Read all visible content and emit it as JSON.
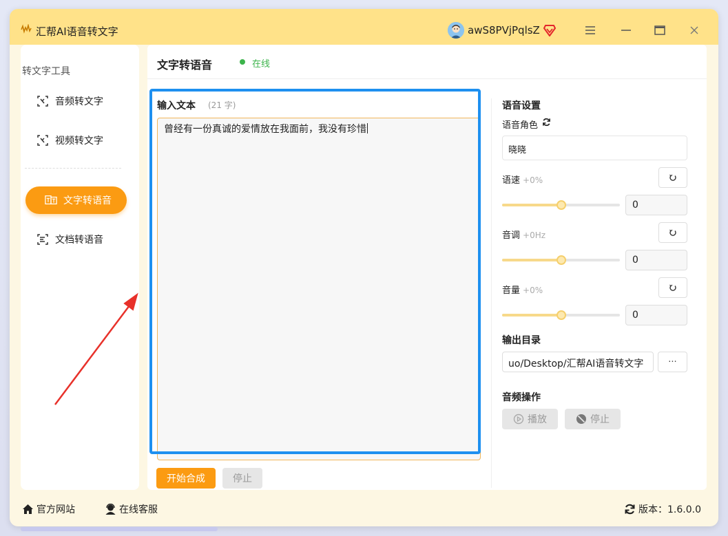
{
  "app": {
    "title": "汇帮AI语音转文字"
  },
  "user": {
    "name": "awS8PVjPqlsZ"
  },
  "sidebar": {
    "heading": "转文字工具",
    "items": [
      {
        "label": "音频转文字",
        "icon": "audio-to-text-icon",
        "active": false
      },
      {
        "label": "视频转文字",
        "icon": "video-to-text-icon",
        "active": false
      },
      {
        "label": "文字转语音",
        "icon": "text-to-speech-icon",
        "active": true
      },
      {
        "label": "文档转语音",
        "icon": "doc-to-speech-icon",
        "active": false
      }
    ]
  },
  "main": {
    "title": "文字转语音",
    "status": "在线",
    "input": {
      "label": "输入文本",
      "count": "(21 字)",
      "value": "曾经有一份真诚的爱情放在我面前，我没有珍惜"
    },
    "start_label": "开始合成",
    "stop_label": "停止"
  },
  "settings": {
    "title": "语音设置",
    "role_label": "语音角色",
    "role_value": "晓晓",
    "speed": {
      "label": "语速",
      "sub": "+0%",
      "value": "0",
      "level": 0.5
    },
    "pitch": {
      "label": "音调",
      "sub": "+0Hz",
      "value": "0",
      "level": 0.5
    },
    "volume": {
      "label": "音量",
      "sub": "+0%",
      "value": "0",
      "level": 0.5
    },
    "output_title": "输出目录",
    "output_path": "uo/Desktop/汇帮AI语音转文字",
    "browse_label": "···",
    "audio_ops_title": "音频操作",
    "play_label": "播放",
    "audio_stop_label": "停止"
  },
  "footer": {
    "website": "官方网站",
    "support": "在线客服",
    "version": "版本：1.6.0.0"
  },
  "colors": {
    "accent": "#fb9b12",
    "titlebar": "#ffe289",
    "highlight": "#1e90f0",
    "online": "#3cb44b",
    "annotation_arrow": "#e8312a"
  }
}
